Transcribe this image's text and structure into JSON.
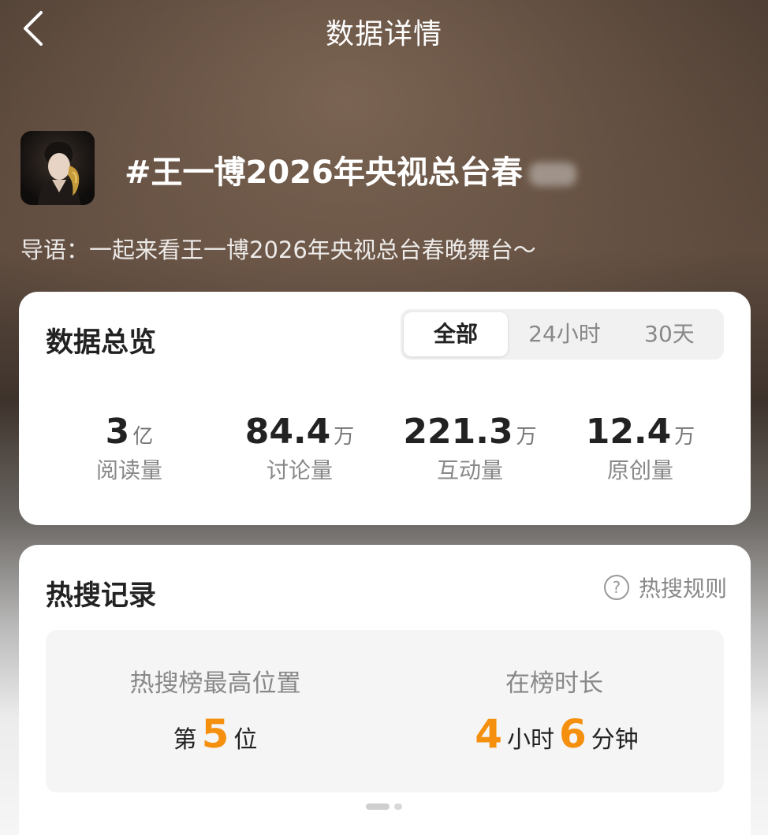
{
  "header": {
    "back_icon": "chevron-left-icon",
    "title": "数据详情"
  },
  "topic": {
    "avatar_icon": "topic-avatar-image",
    "title": "#王一博2026年央视总台春",
    "intro": "导语：一起来看王一博2026年央视总台春晚舞台～"
  },
  "overview": {
    "heading": "数据总览",
    "tabs": [
      {
        "label": "全部",
        "active": true
      },
      {
        "label": "24小时",
        "active": false
      },
      {
        "label": "30天",
        "active": false
      }
    ],
    "stats": [
      {
        "value": "3",
        "unit": "亿",
        "label": "阅读量"
      },
      {
        "value": "84.4",
        "unit": "万",
        "label": "讨论量"
      },
      {
        "value": "221.3",
        "unit": "万",
        "label": "互动量"
      },
      {
        "value": "12.4",
        "unit": "万",
        "label": "原创量"
      }
    ]
  },
  "hot_search": {
    "heading": "热搜记录",
    "rules_icon": "question-circle-icon",
    "rules_label": "热搜规则",
    "peak": {
      "label": "热搜榜最高位置",
      "prefix": "第",
      "value": "5",
      "suffix": "位"
    },
    "duration": {
      "label": "在榜时长",
      "hours": "4",
      "hours_unit": "小时",
      "minutes": "6",
      "minutes_unit": "分钟"
    }
  },
  "colors": {
    "accent_orange": "#f5900e",
    "card_bg": "#ffffff",
    "text_primary": "#222222",
    "text_secondary": "#888888"
  }
}
